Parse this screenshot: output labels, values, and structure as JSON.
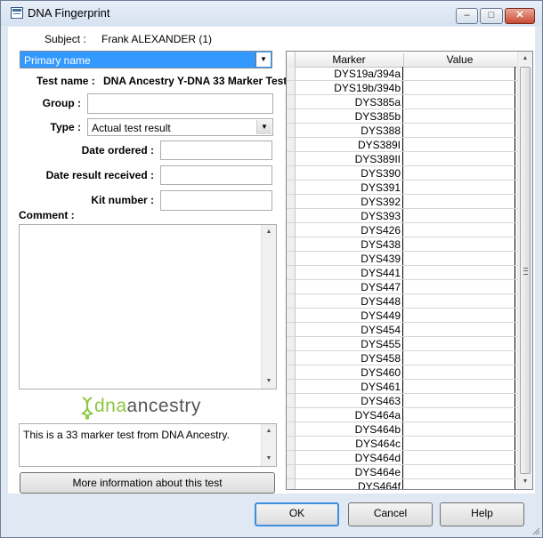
{
  "window": {
    "title": "DNA Fingerprint",
    "minimize": "–",
    "maximize": "□",
    "close": "✕"
  },
  "subject": {
    "label": "Subject :",
    "value": "Frank ALEXANDER (1)"
  },
  "name_combo": {
    "value": "Primary name"
  },
  "test": {
    "label": "Test name :",
    "value": "DNA Ancestry Y-DNA 33 Marker Test"
  },
  "group": {
    "label": "Group :",
    "value": ""
  },
  "type": {
    "label": "Type :",
    "value": "Actual test result"
  },
  "date_ordered": {
    "label": "Date ordered :",
    "value": ""
  },
  "date_received": {
    "label": "Date result received :",
    "value": ""
  },
  "kit_number": {
    "label": "Kit number :",
    "value": ""
  },
  "comment": {
    "label": "Comment :",
    "value": ""
  },
  "logo": {
    "brand": "dna",
    "brand_rest": "ancestry"
  },
  "description": "This is a 33 marker test from DNA Ancestry.",
  "more_info_button": "More information about this test",
  "grid": {
    "headers": [
      "Marker",
      "Value"
    ],
    "markers": [
      "DYS19a/394a",
      "DYS19b/394b",
      "DYS385a",
      "DYS385b",
      "DYS388",
      "DYS389I",
      "DYS389II",
      "DYS390",
      "DYS391",
      "DYS392",
      "DYS393",
      "DYS426",
      "DYS438",
      "DYS439",
      "DYS441",
      "DYS447",
      "DYS448",
      "DYS449",
      "DYS454",
      "DYS455",
      "DYS458",
      "DYS460",
      "DYS461",
      "DYS463",
      "DYS464a",
      "DYS464b",
      "DYS464c",
      "DYS464d",
      "DYS464e",
      "DYS464f"
    ]
  },
  "buttons": {
    "ok": "OK",
    "cancel": "Cancel",
    "help": "Help"
  },
  "colors": {
    "selection": "#3399ff",
    "default_border": "#3d8ee0",
    "logo_green": "#8cc63f"
  }
}
